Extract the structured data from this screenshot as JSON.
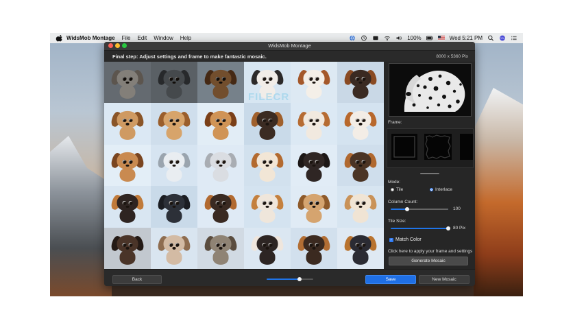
{
  "menubar": {
    "app_name": "WidsMob Montage",
    "menus": [
      "File",
      "Edit",
      "Window",
      "Help"
    ],
    "battery": "100%",
    "clock": "Wed 5:21 PM"
  },
  "window": {
    "title": "WidsMob Montage",
    "step_text": "Final step: Adjust settings and frame to make fantastic mosaic.",
    "output_size": "8000 x 5360 Pix"
  },
  "panel": {
    "frame_label": "Frame:",
    "mode_label": "Mode:",
    "mode_options": [
      "Tile",
      "Interlace"
    ],
    "mode_selected": "Interlace",
    "column_count_label": "Column Count:",
    "column_count_value": "100",
    "column_count_fraction": 0.28,
    "tile_size_label": "Tile Size:",
    "tile_size_value": "80 Pix",
    "tile_size_fraction": 1.0,
    "match_color_label": "Match Color",
    "match_color_checked": true,
    "apply_hint": "Click here to apply your frame and settings",
    "generate_label": "Generate Mosaic"
  },
  "bottom": {
    "back_label": "Back",
    "save_label": "Save",
    "new_mosaic_label": "New Mosaic",
    "zoom_fraction": 0.7
  },
  "watermark_text": "FILECR",
  "colors": {
    "accent": "#1f6fe5",
    "window_bg": "#2b2b2b",
    "panel_bg": "#262626"
  },
  "mosaic_tiles": [
    {
      "bg": "#9aa3ad",
      "fur": "#c9c3bb",
      "ear": "#8e8378",
      "dim": true
    },
    {
      "bg": "#8b949c",
      "fur": "#6b7075",
      "ear": "#3c3f42",
      "dim": true
    },
    {
      "bg": "#b6c6d4",
      "fur": "#b07846",
      "ear": "#6a3f20",
      "dim": true
    },
    {
      "bg": "#d7e6f2",
      "fur": "#f1ede8",
      "ear": "#2c2a2a",
      "dim": false
    },
    {
      "bg": "#dde9f3",
      "fur": "#f4efe8",
      "ear": "#a4582a",
      "dim": false
    },
    {
      "bg": "#c9d8e6",
      "fur": "#3a2a22",
      "ear": "#8a4a22",
      "dim": false
    },
    {
      "bg": "#dbe8f4",
      "fur": "#cf9a62",
      "ear": "#8a5528",
      "dim": false
    },
    {
      "bg": "#cfdeec",
      "fur": "#d7a46b",
      "ear": "#9a5e2c",
      "dim": false
    },
    {
      "bg": "#e2edf6",
      "fur": "#d09456",
      "ear": "#7a3f18",
      "dim": false
    },
    {
      "bg": "#c9dae9",
      "fur": "#3b2b22",
      "ear": "#a0602c",
      "dim": false
    },
    {
      "bg": "#dce9f4",
      "fur": "#f1e9df",
      "ear": "#b66c33",
      "dim": false
    },
    {
      "bg": "#d4e3f0",
      "fur": "#f3ede6",
      "ear": "#b8682c",
      "dim": false
    },
    {
      "bg": "#e3eef7",
      "fur": "#c98a50",
      "ear": "#7a4520",
      "dim": false
    },
    {
      "bg": "#d6e4f1",
      "fur": "#e9edf1",
      "ear": "#9aa4ae",
      "dim": false
    },
    {
      "bg": "#dfeaf5",
      "fur": "#dadde2",
      "ear": "#a9adb3",
      "dim": false
    },
    {
      "bg": "#d2e1ee",
      "fur": "#f2e6d6",
      "ear": "#b36a2f",
      "dim": false
    },
    {
      "bg": "#e1ecf6",
      "fur": "#2f2624",
      "ear": "#1c1716",
      "dim": false
    },
    {
      "bg": "#cfdeec",
      "fur": "#4b3424",
      "ear": "#b0682f",
      "dim": false
    },
    {
      "bg": "#d9e6f2",
      "fur": "#2e2421",
      "ear": "#c07a3a",
      "dim": false
    },
    {
      "bg": "#c9dae9",
      "fur": "#2c3038",
      "ear": "#1b1d22",
      "dim": false
    },
    {
      "bg": "#dfeaf5",
      "fur": "#3a2a22",
      "ear": "#b26a30",
      "dim": false
    },
    {
      "bg": "#d4e3f0",
      "fur": "#efe6db",
      "ear": "#c4803e",
      "dim": false
    },
    {
      "bg": "#e0ebf5",
      "fur": "#d5a46f",
      "ear": "#8e5a2a",
      "dim": false
    },
    {
      "bg": "#d7e5f1",
      "fur": "#f0e4d4",
      "ear": "#c99258",
      "dim": false
    },
    {
      "bg": "#c2c8cf",
      "fur": "#4a3428",
      "ear": "#241a15",
      "dim": false
    },
    {
      "bg": "#d9e5f0",
      "fur": "#d3bba4",
      "ear": "#8e6d50",
      "dim": false
    },
    {
      "bg": "#d1dae3",
      "fur": "#8f8374",
      "ear": "#5a4c3e",
      "dim": false
    },
    {
      "bg": "#dbe7f2",
      "fur": "#2d2523",
      "ear": "#efe6dd",
      "dim": false
    },
    {
      "bg": "#d2e0ed",
      "fur": "#3b2a20",
      "ear": "#b26e34",
      "dim": false
    },
    {
      "bg": "#dfe9f3",
      "fur": "#2b2b33",
      "ear": "#b9732f",
      "dim": false
    }
  ]
}
